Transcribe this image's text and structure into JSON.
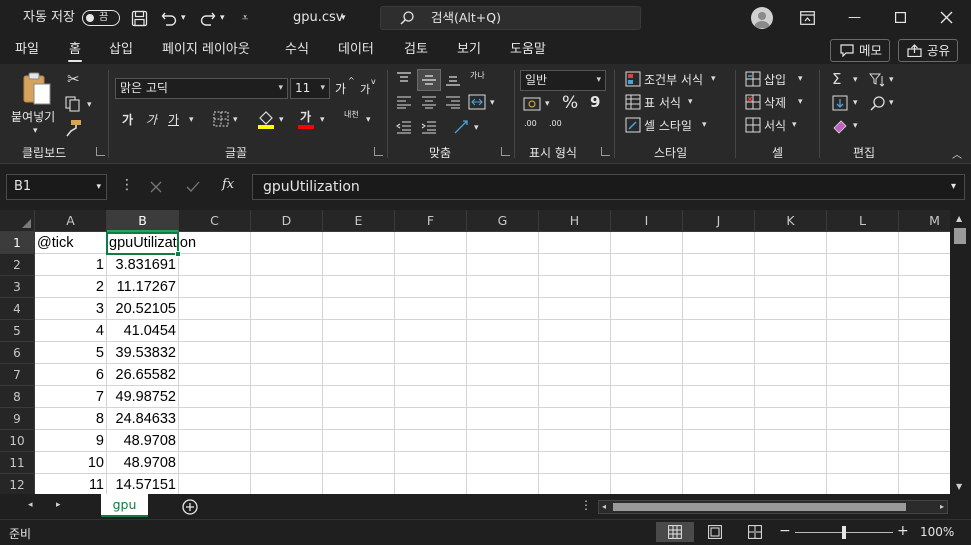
{
  "titlebar": {
    "autosave_label": "자동 저장",
    "autosave_state": "끔",
    "filename": "gpu.csv",
    "search_label": "검색(Alt+Q)"
  },
  "menu": {
    "tabs": [
      "파일",
      "홈",
      "삽입",
      "페이지 레이아웃",
      "수식",
      "데이터",
      "검토",
      "보기",
      "도움말"
    ],
    "active_tab": "홈",
    "memo_button": "메모",
    "share_button": "공유"
  },
  "ribbon": {
    "clipboard": {
      "paste": "붙여넣기",
      "label": "클립보드"
    },
    "font": {
      "name": "맑은 고딕",
      "size": "11",
      "bold": "가",
      "italic": "가",
      "underline": "가",
      "font_color_glyph": "가",
      "phonetic": "내천",
      "grow": "가",
      "shrink": "가",
      "label": "글꼴"
    },
    "alignment": {
      "wrap": "가나",
      "label": "맞춤"
    },
    "number": {
      "format": "일반",
      "percent": "%",
      "comma": "9",
      "increase_decimal": ".00",
      "decrease_decimal": ".00",
      "label": "표시 형식"
    },
    "styles": {
      "conditional": "조건부 서식",
      "table": "표 서식",
      "cell": "셀 스타일",
      "label": "스타일"
    },
    "cells": {
      "insert": "삽입",
      "delete": "삭제",
      "format": "서식",
      "label": "셀"
    },
    "editing": {
      "label": "편집"
    }
  },
  "formula_bar": {
    "name_box": "B1",
    "fx": "fx",
    "content": "gpuUtilization"
  },
  "grid": {
    "columns": [
      "A",
      "B",
      "C",
      "D",
      "E",
      "F",
      "G",
      "H",
      "I",
      "J",
      "K",
      "L",
      "M"
    ],
    "rows": [
      "1",
      "2",
      "3",
      "4",
      "5",
      "6",
      "7",
      "8",
      "9",
      "10",
      "11",
      "12"
    ],
    "selected_column": "B",
    "selected_row": "1",
    "header_row": {
      "a": "@tick",
      "b": "gpuUtilization"
    },
    "data": [
      {
        "tick": "1",
        "gpu": "3.831691"
      },
      {
        "tick": "2",
        "gpu": "11.17267"
      },
      {
        "tick": "3",
        "gpu": "20.52105"
      },
      {
        "tick": "4",
        "gpu": "41.0454"
      },
      {
        "tick": "5",
        "gpu": "39.53832"
      },
      {
        "tick": "6",
        "gpu": "26.65582"
      },
      {
        "tick": "7",
        "gpu": "49.98752"
      },
      {
        "tick": "8",
        "gpu": "24.84633"
      },
      {
        "tick": "9",
        "gpu": "48.9708"
      },
      {
        "tick": "10",
        "gpu": "48.9708"
      },
      {
        "tick": "11",
        "gpu": "14.57151"
      }
    ]
  },
  "sheets": {
    "active": "gpu"
  },
  "status": {
    "ready": "준비",
    "zoom_out": "−",
    "zoom_in": "+",
    "zoom_value": 100,
    "zoom": "100%"
  },
  "colors": {
    "accent": "#107c41",
    "ribbon_bg": "#292929",
    "window_bg": "#1f1f1f"
  }
}
